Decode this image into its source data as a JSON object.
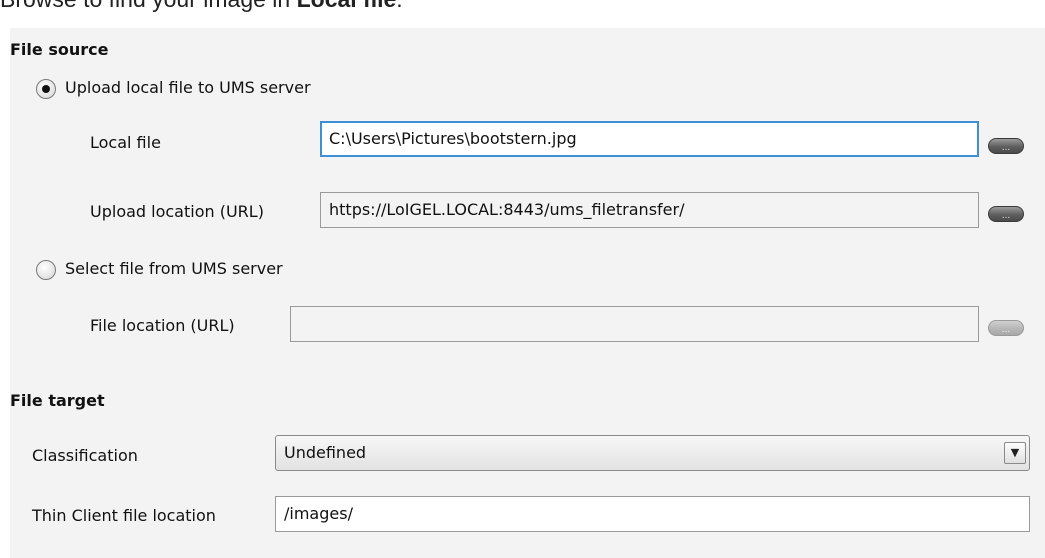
{
  "intro": {
    "prefix": "Browse to find your image in ",
    "bold": "Local file",
    "suffix": "."
  },
  "file_source": {
    "title": "File source",
    "upload_radio_label": "Upload local file to UMS server",
    "local_file_label": "Local file",
    "local_file_value": "C:\\Users\\Pictures\\bootstern.jpg",
    "upload_location_label": "Upload location (URL)",
    "upload_location_value": "https://LoIGEL.LOCAL:8443/ums_filetransfer/",
    "select_radio_label": "Select file from UMS server",
    "file_location_label": "File location (URL)",
    "file_location_value": "",
    "browse_label": "..."
  },
  "file_target": {
    "title": "File target",
    "classification_label": "Classification",
    "classification_value": "Undefined",
    "classification_arrow": "▼",
    "tc_location_label": "Thin Client file location",
    "tc_location_value": "/images/"
  }
}
